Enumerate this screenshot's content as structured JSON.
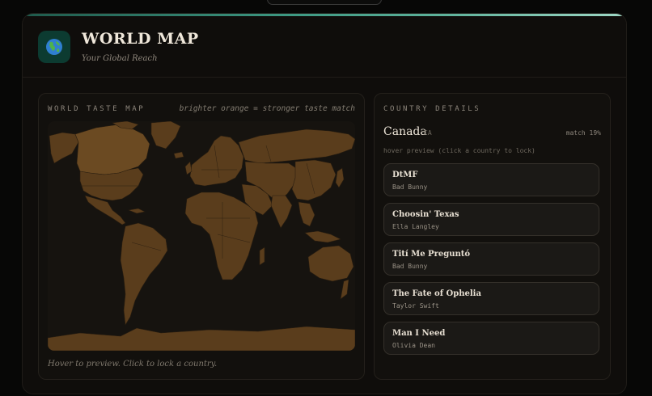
{
  "header": {
    "title": "WORLD MAP",
    "subtitle": "Your Global Reach",
    "logo_icon": "globe-icon"
  },
  "map_panel": {
    "label": "WORLD TASTE MAP",
    "hint": "brighter orange = stronger taste match",
    "footer": "Hover to preview. Click to lock a country.",
    "land_color": "#5a3d1c",
    "highlight_color": "#6b4a22",
    "border_color": "#2a1e10"
  },
  "details": {
    "label": "COUNTRY DETAILS",
    "country": "Canada",
    "code": "CA",
    "match": "match 19%",
    "hover_note": "hover preview (click a country to lock)",
    "songs": [
      {
        "title": "DtMF",
        "artist": "Bad Bunny"
      },
      {
        "title": "Choosin' Texas",
        "artist": "Ella Langley"
      },
      {
        "title": "Tití Me Preguntó",
        "artist": "Bad Bunny"
      },
      {
        "title": "The Fate of Ophelia",
        "artist": "Taylor Swift"
      },
      {
        "title": "Man I Need",
        "artist": "Olivia Dean"
      }
    ]
  }
}
